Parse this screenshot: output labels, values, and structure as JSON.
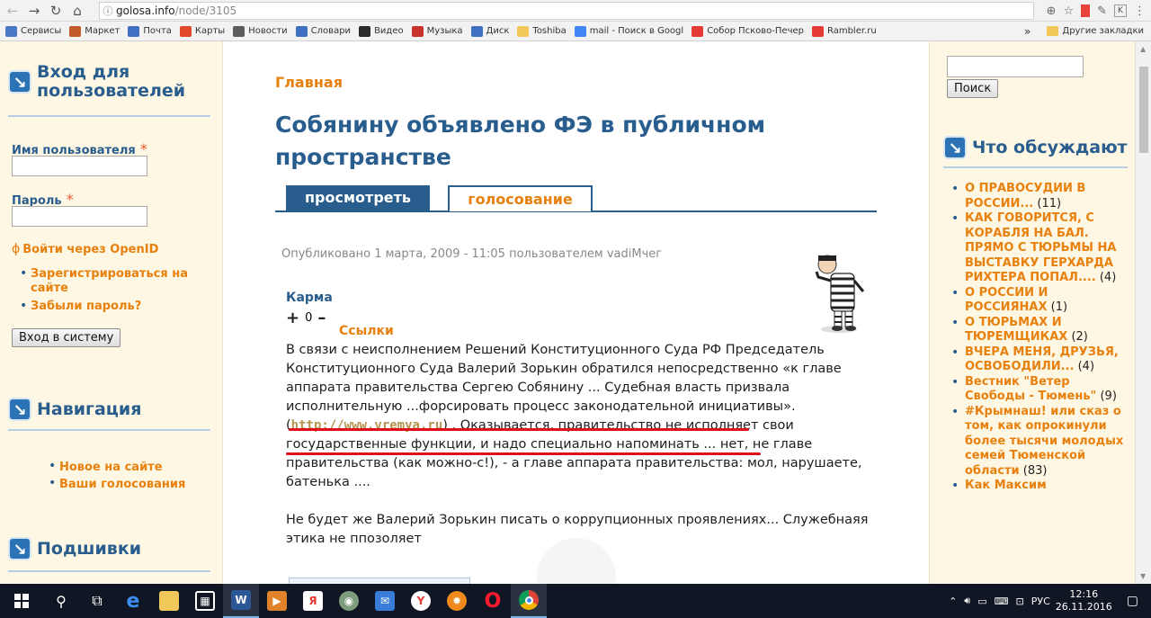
{
  "browser": {
    "url_host": "golosa.info",
    "url_path": "/node/3105",
    "bookmarks": [
      {
        "label": "Сервисы",
        "icon": "apps-grid-icon",
        "color": "#4a78c9"
      },
      {
        "label": "Маркет",
        "icon": "market-icon",
        "color": "#c35a2c"
      },
      {
        "label": "Почта",
        "icon": "mail-icon",
        "color": "#3f70c2"
      },
      {
        "label": "Карты",
        "icon": "map-pin-icon",
        "color": "#e04a2a"
      },
      {
        "label": "Новости",
        "icon": "news-icon",
        "color": "#5c5c5c"
      },
      {
        "label": "Словари",
        "icon": "dictionary-icon",
        "color": "#3f70c2"
      },
      {
        "label": "Видео",
        "icon": "video-icon",
        "color": "#2a2a2a"
      },
      {
        "label": "Музыка",
        "icon": "music-icon",
        "color": "#c8332e"
      },
      {
        "label": "Диск",
        "icon": "disk-icon",
        "color": "#3f70c2"
      },
      {
        "label": "Toshiba",
        "icon": "folder-icon",
        "color": "#f2c85a"
      },
      {
        "label": "mail - Поиск в Googl",
        "icon": "google-icon",
        "color": "#4285f4"
      },
      {
        "label": "Собор Псково-Печер",
        "icon": "yandex-icon",
        "color": "#e53935"
      },
      {
        "label": "Rambler.ru",
        "icon": "yandex-icon",
        "color": "#e53935"
      }
    ],
    "bookmarks_more": "»",
    "other_bookmarks": "Другие закладки"
  },
  "left_sidebar": {
    "login_title": "Вход для пользователей",
    "username_label": "Имя пользователя",
    "password_label": "Пароль",
    "required_mark": "*",
    "openid_link": "Войти через OpenID",
    "links": [
      "Зарегистрироваться на сайте",
      "Забыли пароль?"
    ],
    "login_button": "Вход в систему",
    "nav_title": "Навигация",
    "nav_links": [
      "Новое на сайте",
      "Ваши голосования"
    ],
    "podshivki_title": "Подшивки"
  },
  "main": {
    "breadcrumb": "Главная",
    "title": "Собянину объявлено ФЭ в публичном пространстве",
    "tabs": [
      {
        "label": "просмотреть",
        "active": true
      },
      {
        "label": "голосование",
        "active": false
      }
    ],
    "submitted": "Опубликовано 1 марта, 2009 - 11:05 пользователем vadiMчег",
    "karma_label": "Карма",
    "karma_plus": "+",
    "karma_score": "0",
    "karma_minus": "–",
    "links_label": "Ссылки",
    "para1_part1": "В связи с неисполнением Решений Конституционного Суда РФ Председатель Конституционного Суда Валерий Зорькин обратился непосредственно «к главе аппарата правительства Сергею Собянину ... Судебная власть призвала исполнительную ...форсировать процесс законодательной инициативы». (",
    "para1_link": "http://www.vremya.ru",
    "para1_part2": ") . Оказывается, правительство не исполняет свои государственные функции, и надо специально напоминать ... нет, не главе правительства (как можно-с!), - а главе аппарата правительства: мол, нарушаете, батенька ....",
    "para2": "Не будет же Валерий Зорькин писать о коррупционных проявлениях... Служебнаяя этика не ппозоляет"
  },
  "right_sidebar": {
    "search_button": "Поиск",
    "discuss_title": "Что обсуждают",
    "items": [
      {
        "title": "О ПРАВОСУДИИ В РОССИИ...",
        "count": "(11)"
      },
      {
        "title": "КАК ГОВОРИТСЯ, С КОРАБЛЯ НА БАЛ. ПРЯМО С ТЮРЬМЫ НА ВЫСТАВКУ ГЕРХАРДА РИХТЕРА ПОПАЛ....",
        "count": "(4)"
      },
      {
        "title": "О РОССИИ И РОССИЯНАХ",
        "count": "(1)"
      },
      {
        "title": "О ТЮРЬМАХ И ТЮРЕМЩИКАХ",
        "count": "(2)"
      },
      {
        "title": "ВЧЕРА МЕНЯ, ДРУЗЬЯ, ОСВОБОДИЛИ...",
        "count": "(4)"
      },
      {
        "title": "Вестник \"Ветер Свободы - Тюмень\"",
        "count": "(9)"
      },
      {
        "title": "#Крымнаш! или сказ о том, как опрокинули более тысячи молодых семей Тюменской области",
        "count": "(83)"
      },
      {
        "title": "Как Максим",
        "count": ""
      }
    ]
  },
  "taskbar": {
    "lang": "РУС",
    "time": "12:16",
    "date": "26.11.2016"
  },
  "colors": {
    "accent_blue": "#285d8e",
    "accent_orange": "#e8800e",
    "underline_red": "#e0101a",
    "sidebar_bg": "#fdf7e3"
  }
}
